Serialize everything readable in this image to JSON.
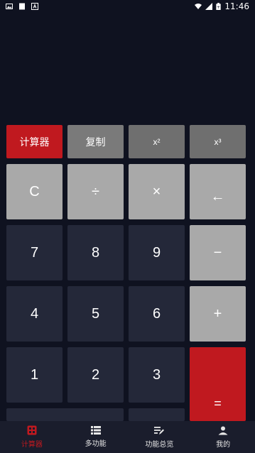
{
  "status_bar": {
    "time": "11:46",
    "battery": "+"
  },
  "mode_row": {
    "calculator": "计算器",
    "copy": "复制",
    "square": "x²",
    "cube": "x³"
  },
  "keys": {
    "clear": "C",
    "divide": "÷",
    "multiply": "×",
    "backspace": "←",
    "seven": "7",
    "eight": "8",
    "nine": "9",
    "minus": "−",
    "four": "4",
    "five": "5",
    "six": "6",
    "plus": "+",
    "one": "1",
    "two": "2",
    "three": "3",
    "equals": "="
  },
  "tabs": [
    {
      "label": "计算器",
      "icon": "calculator-icon",
      "active": true
    },
    {
      "label": "多功能",
      "icon": "list-icon",
      "active": false
    },
    {
      "label": "功能总览",
      "icon": "edit-list-icon",
      "active": false
    },
    {
      "label": "我的",
      "icon": "user-icon",
      "active": false
    }
  ],
  "colors": {
    "accent": "#c0191f",
    "background": "#0f1220",
    "dark_key": "#242839",
    "light_key": "#a9a9a9"
  }
}
